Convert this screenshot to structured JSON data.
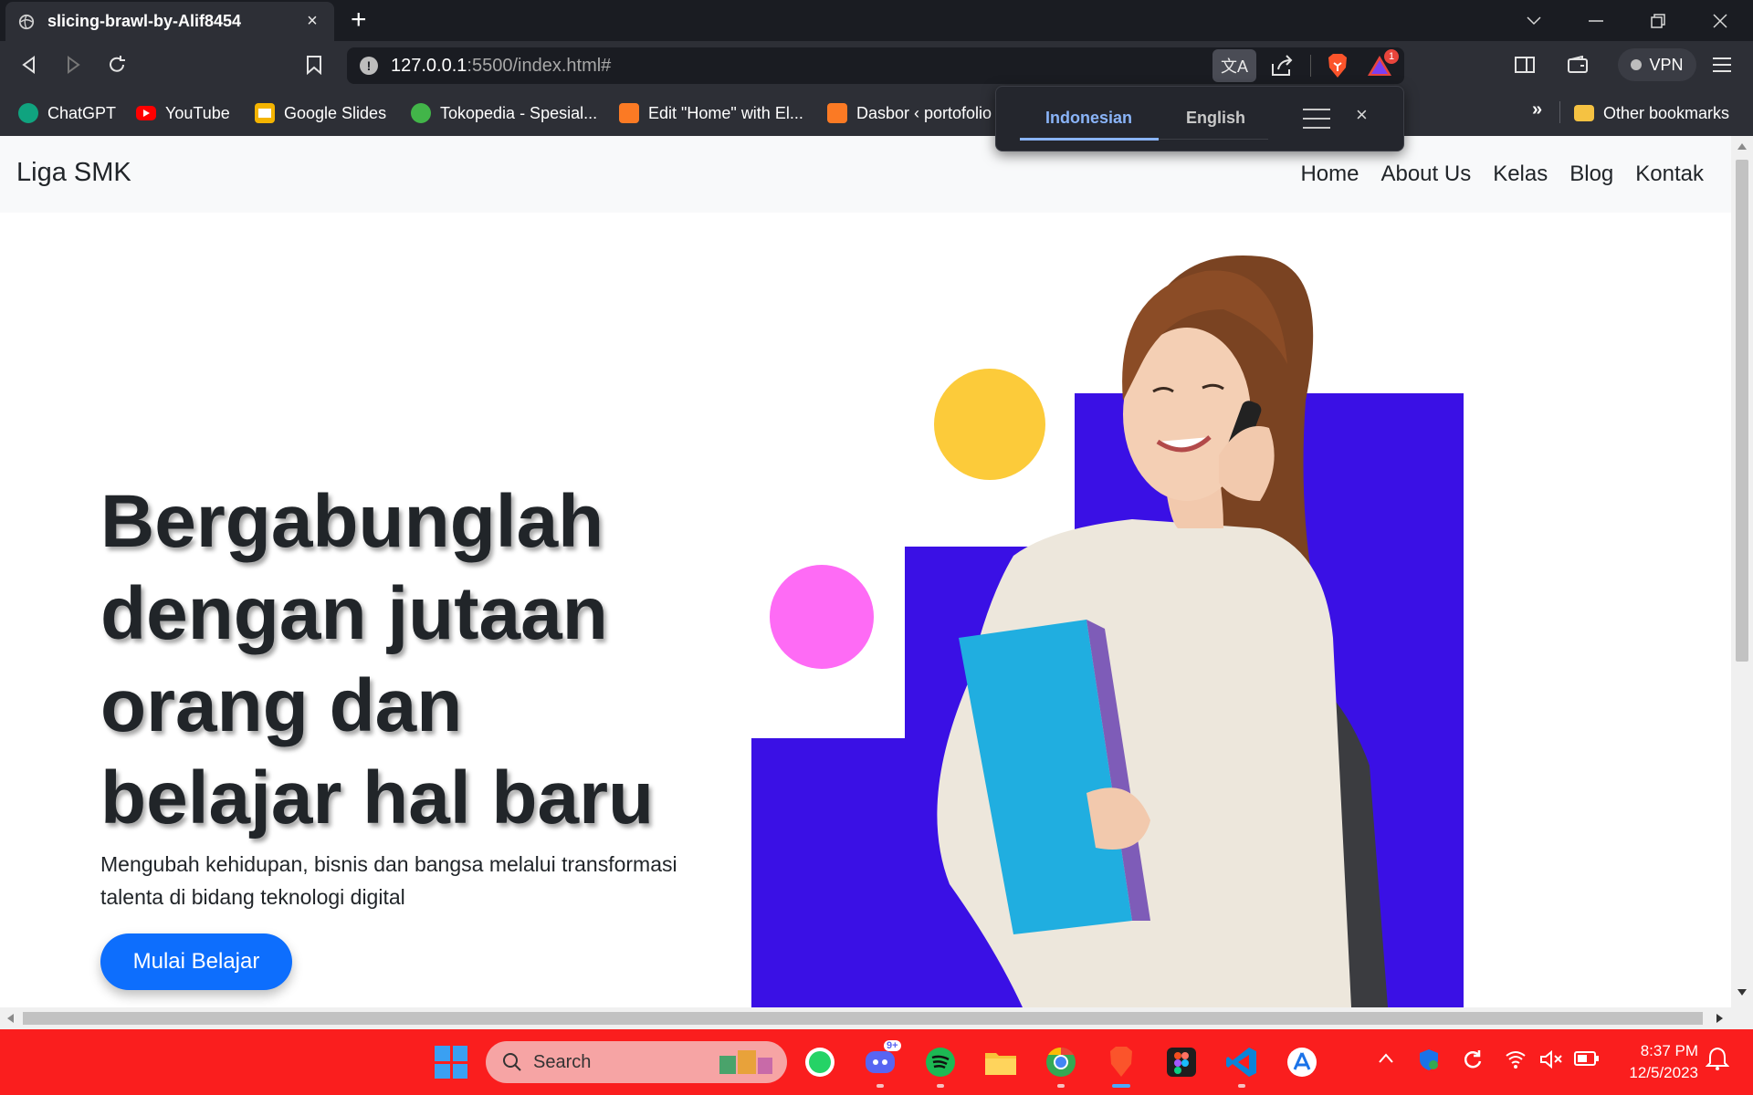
{
  "browser": {
    "tab": {
      "title": "slicing-brawl-by-Alif8454",
      "close_label": "×"
    },
    "new_tab_label": "+",
    "url": {
      "host": "127.0.0.1",
      "rest": ":5500/index.html#"
    },
    "notification_count": "1",
    "vpn_label": "VPN",
    "bookmarks": [
      {
        "label": "ChatGPT",
        "icon": "chatgpt-icon"
      },
      {
        "label": "YouTube",
        "icon": "youtube-icon"
      },
      {
        "label": "Google Slides",
        "icon": "google-slides-icon"
      },
      {
        "label": "Tokopedia - Spesial...",
        "icon": "tokopedia-icon"
      },
      {
        "label": "Edit \"Home\" with El...",
        "icon": "xampp-icon"
      },
      {
        "label": "Dasbor ‹ portofolio",
        "icon": "xampp-icon"
      }
    ],
    "bookmarks_overflow": "»",
    "other_bookmarks": "Other bookmarks"
  },
  "translate_popup": {
    "languages": [
      "Indonesian",
      "English"
    ],
    "active_language": "Indonesian",
    "close_label": "×"
  },
  "site": {
    "brand": "Liga SMK",
    "nav": [
      "Home",
      "About Us",
      "Kelas",
      "Blog",
      "Kontak"
    ],
    "hero": {
      "title_lines": [
        "Bergabunglah",
        "dengan jutaan",
        "orang dan",
        "belajar hal baru"
      ],
      "subtitle_lines": [
        "Mengubah kehidupan, bisnis dan bangsa melalui transformasi",
        "talenta di bidang teknologi digital"
      ],
      "cta": "Mulai Belajar"
    }
  },
  "taskbar": {
    "search_placeholder": "Search",
    "discord_badge": "9+",
    "time": "8:37 PM",
    "date": "12/5/2023"
  },
  "colors": {
    "accent_blue": "#0d6efd",
    "hero_purple": "#3a10e5",
    "circle_yellow": "#fccb3a",
    "circle_pink": "#fe6bf5",
    "taskbar_red": "#fa1e1e"
  }
}
